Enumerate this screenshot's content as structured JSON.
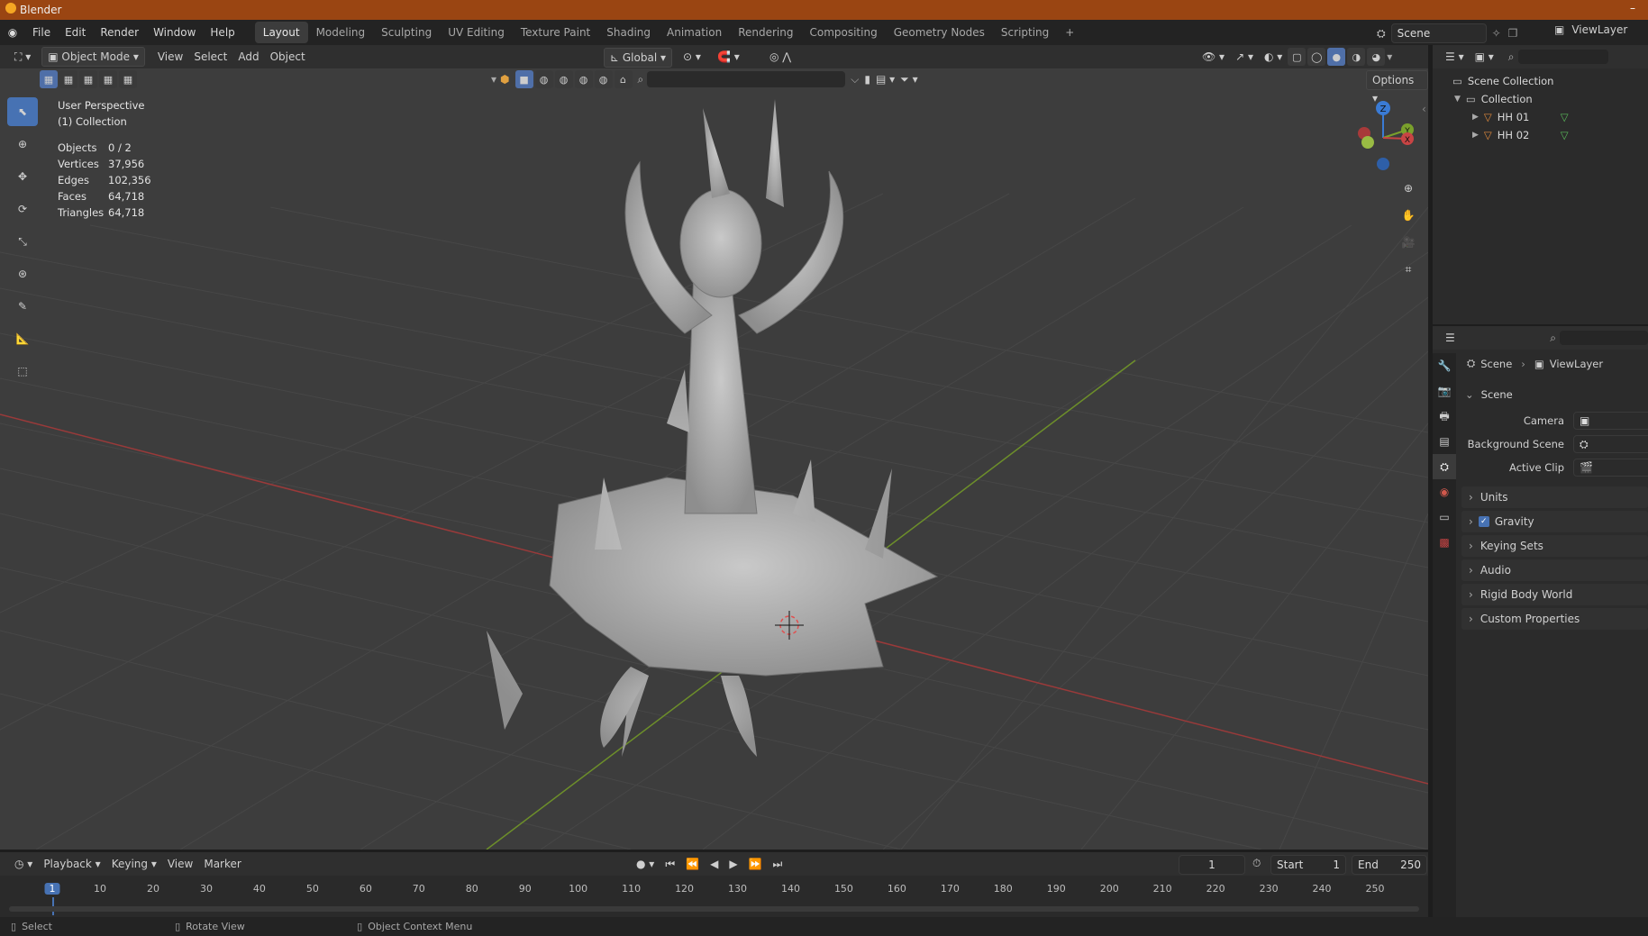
{
  "window": {
    "title": "Blender"
  },
  "menu": [
    "File",
    "Edit",
    "Render",
    "Window",
    "Help"
  ],
  "workspaces": {
    "items": [
      "Layout",
      "Modeling",
      "Sculpting",
      "UV Editing",
      "Texture Paint",
      "Shading",
      "Animation",
      "Rendering",
      "Compositing",
      "Geometry Nodes",
      "Scripting"
    ],
    "active": "Layout",
    "add": "+"
  },
  "scene_field": "Scene",
  "viewlayer_field": "ViewLayer",
  "viewport_header": {
    "mode": "Object Mode",
    "menus": [
      "View",
      "Select",
      "Add",
      "Object"
    ],
    "orientation": "Global",
    "options": "Options"
  },
  "overlay_text": {
    "perspective": "User Perspective",
    "collection": "(1) Collection",
    "stats": [
      {
        "label": "Objects",
        "value": "0 / 2"
      },
      {
        "label": "Vertices",
        "value": "37,956"
      },
      {
        "label": "Edges",
        "value": "102,356"
      },
      {
        "label": "Faces",
        "value": "64,718"
      },
      {
        "label": "Triangles",
        "value": "64,718"
      }
    ]
  },
  "gizmo": {
    "x": "X",
    "y": "Y",
    "z": "Z"
  },
  "outliner": {
    "root": "Scene Collection",
    "collection": "Collection",
    "objects": [
      "HH 01",
      "HH 02"
    ]
  },
  "properties": {
    "breadcrumb_scene": "Scene",
    "breadcrumb_viewlayer": "ViewLayer",
    "panel_title": "Scene",
    "fields": [
      {
        "label": "Camera"
      },
      {
        "label": "Background Scene"
      },
      {
        "label": "Active Clip"
      }
    ],
    "panels": [
      "Units",
      "Gravity",
      "Keying Sets",
      "Audio",
      "Rigid Body World",
      "Custom Properties"
    ],
    "gravity_checked": true
  },
  "timeline": {
    "menus": [
      "Playback",
      "Keying",
      "View",
      "Marker"
    ],
    "current_frame": "1",
    "start_label": "Start",
    "start": "1",
    "end_label": "End",
    "end": "250",
    "ticks": [
      "1",
      "10",
      "20",
      "30",
      "40",
      "50",
      "60",
      "70",
      "80",
      "90",
      "100",
      "110",
      "120",
      "130",
      "140",
      "150",
      "160",
      "170",
      "180",
      "190",
      "200",
      "210",
      "220",
      "230",
      "240",
      "250"
    ]
  },
  "status": {
    "select": "Select",
    "rotate": "Rotate View",
    "context": "Object Context Menu"
  },
  "colors": {
    "accent": "#4772b3",
    "titlebar": "#9a4512",
    "x_axis": "#c84444",
    "y_axis": "#7aa02c",
    "z_axis": "#3a7bd5"
  }
}
